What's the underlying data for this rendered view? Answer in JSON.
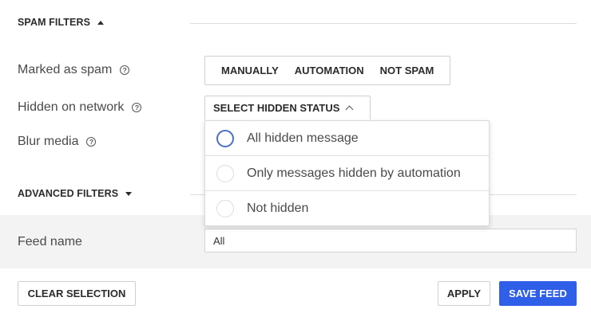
{
  "spam_filters": {
    "title": "SPAM FILTERS",
    "rows": {
      "marked_as_spam": {
        "label": "Marked as spam",
        "options": [
          "MANUALLY",
          "AUTOMATION",
          "NOT SPAM"
        ]
      },
      "hidden_on_network": {
        "label": "Hidden on network",
        "select_label": "SELECT HIDDEN STATUS",
        "dropdown_options": [
          "All hidden message",
          "Only messages hidden by automation",
          "Not hidden"
        ]
      },
      "blur_media": {
        "label": "Blur media"
      }
    },
    "help_glyph": "?"
  },
  "advanced_filters": {
    "title": "ADVANCED FILTERS"
  },
  "feed": {
    "label": "Feed name",
    "value": "All"
  },
  "footer": {
    "clear_label": "CLEAR SELECTION",
    "apply_label": "APPLY",
    "save_label": "SAVE FEED"
  },
  "colors": {
    "primary": "#2f5fe8",
    "radio_focus": "#4a70c8"
  }
}
